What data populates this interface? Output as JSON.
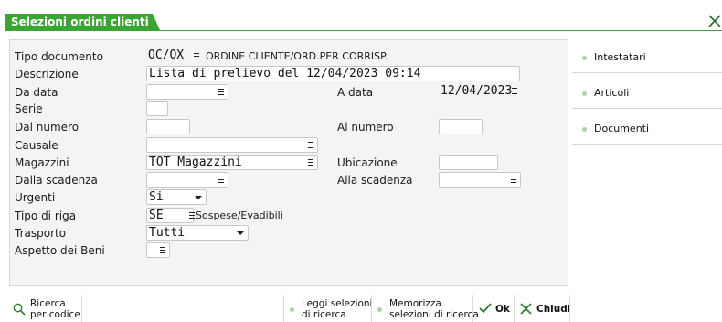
{
  "window": {
    "title": "Selezioni ordini clienti",
    "close_icon": "close-icon"
  },
  "form": {
    "tipo_documento": {
      "label": "Tipo documento",
      "code": "OC/OX",
      "description": "ORDINE CLIENTE/ORD.PER CORRISP."
    },
    "descrizione": {
      "label": "Descrizione",
      "value": "Lista di prelievo del 12/04/2023 09:14"
    },
    "da_data": {
      "label": "Da data",
      "value": ""
    },
    "a_data": {
      "label": "A data",
      "value": "12/04/2023"
    },
    "serie": {
      "label": "Serie",
      "value": ""
    },
    "dal_numero": {
      "label": "Dal numero",
      "value": ""
    },
    "al_numero": {
      "label": "Al numero",
      "value": ""
    },
    "causale": {
      "label": "Causale",
      "value": ""
    },
    "magazzini": {
      "label": "Magazzini",
      "value": "TOT Magazzini"
    },
    "ubicazione": {
      "label": "Ubicazione",
      "value": ""
    },
    "dalla_scadenza": {
      "label": "Dalla scadenza",
      "value": ""
    },
    "alla_scadenza": {
      "label": "Alla scadenza",
      "value": ""
    },
    "urgenti": {
      "label": "Urgenti",
      "value": "Si"
    },
    "tipo_di_riga": {
      "label": "Tipo di riga",
      "code": "SE",
      "description": "Sospese/Evadibili"
    },
    "trasporto": {
      "label": "Trasporto",
      "value": "Tutti"
    },
    "aspetto_dei_beni": {
      "label": "Aspetto dei Beni",
      "value": ""
    }
  },
  "sidebar": {
    "items": [
      {
        "label": "Intestatari"
      },
      {
        "label": "Articoli"
      },
      {
        "label": "Documenti"
      }
    ]
  },
  "toolbar": {
    "ricerca": {
      "line1": "Ricerca",
      "line2": "per codice"
    },
    "leggi": {
      "line1": "Leggi selezioni",
      "line2": "di ricerca"
    },
    "memorizza": {
      "line1": "Memorizza",
      "line2": "selezioni di ricerca"
    },
    "ok": "Ok",
    "chiudi": "Chiudi"
  },
  "colors": {
    "accent": "#3aa535",
    "panel_bg": "#f4f4f4",
    "dot": "#a8d6a3"
  }
}
